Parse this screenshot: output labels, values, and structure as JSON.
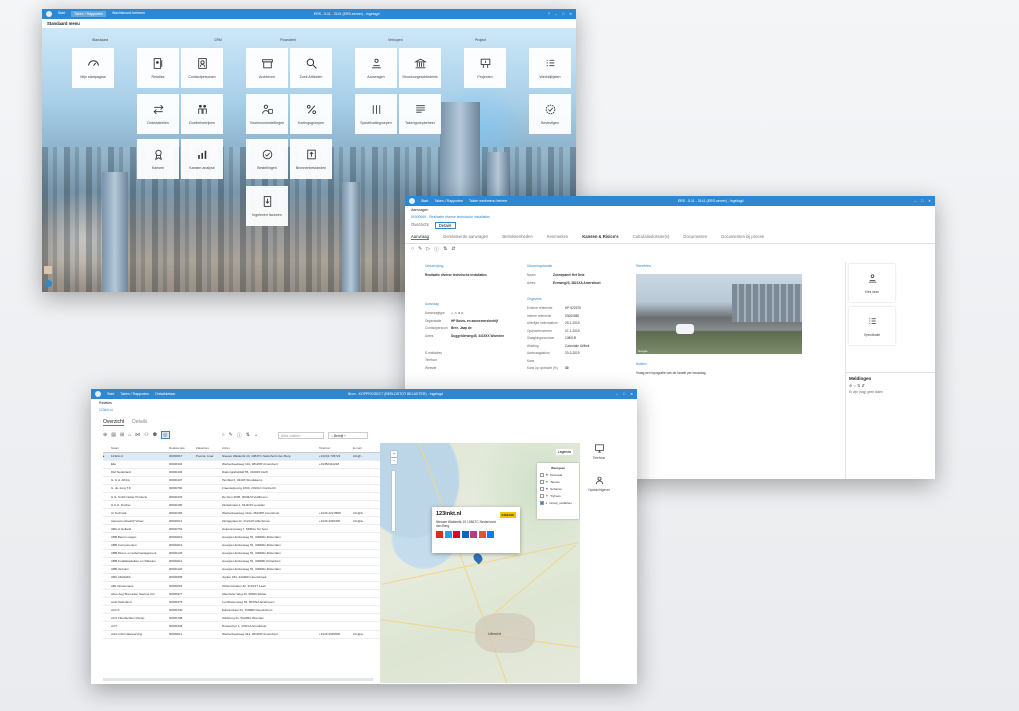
{
  "winA": {
    "title": "ERS - 5.11 - 3141 (ERS-server) - Ingelogd",
    "menu": [
      "Start",
      "Taken / Rapporten",
      "Wachtwoord beheren"
    ],
    "heading": "Standaard menu",
    "sections": [
      "Standaard",
      "CRM",
      "Financieel",
      "Verkopen",
      "Project"
    ],
    "tiles": [
      {
        "label": "Mijn startpagina",
        "icon": "dashboard-icon"
      },
      {
        "label": "Relaties",
        "icon": "contacts-icon"
      },
      {
        "label": "Contactpersonen",
        "icon": "person-card-icon"
      },
      {
        "label": "Archieven",
        "icon": "archive-icon"
      },
      {
        "label": "Zoek Artikelen",
        "icon": "search-icon"
      },
      {
        "label": "Aanvragen",
        "icon": "request-icon"
      },
      {
        "label": "Structuurgeschiedenis",
        "icon": "building-icon"
      },
      {
        "label": "Projecten",
        "icon": "projects-icon"
      },
      {
        "label": "Werkbijlijsten",
        "icon": "list-icon"
      },
      {
        "label": "Ordertabellen",
        "icon": "arrows-icon"
      },
      {
        "label": "Doelbeheerijsen",
        "icon": "people-icon"
      },
      {
        "label": "Voorkeursinstellingen",
        "icon": "user-settings-icon"
      },
      {
        "label": "Kortingsgroepen",
        "icon": "percent-icon"
      },
      {
        "label": "Specificatiegroepen",
        "icon": "lines-icon"
      },
      {
        "label": "Takengroepbeheer",
        "icon": "text-list-icon"
      },
      {
        "label": "Bevestigen",
        "icon": "badge-check-icon"
      },
      {
        "label": "Kansen",
        "icon": "award-icon"
      },
      {
        "label": "Kansen analyse",
        "icon": "bar-chart-icon"
      },
      {
        "label": "Bestellingen",
        "icon": "check-circle-icon"
      },
      {
        "label": "Bronnenbestanden",
        "icon": "export-icon"
      },
      {
        "label": "Ingelezen facturen",
        "icon": "invoice-import-icon"
      }
    ]
  },
  "winB": {
    "title": "ERS - 5.11 - 3141 (ERS-server) - Ingelogd",
    "menu": [
      "Start",
      "Taken / Rapporten",
      "Taken werkmenu beheer"
    ],
    "breadcrumb": "Aanvragen",
    "sub_breadcrumb": "00000669 - Realisatie diverse technische installaties",
    "view_tabs": [
      "Overzicht",
      "Details"
    ],
    "tabs": [
      "Aanvraag",
      "Gerelateerde aanvragen",
      "Betrokkenheden",
      "Kenmerken",
      "Kansen & Risico's",
      "Calculatiedossier(s)",
      "Documenten",
      "Documenten bij proces"
    ],
    "omschrijving": {
      "heading": "Omschrijving",
      "value": "Realisatie diverse technische installaties"
    },
    "aanvraag": {
      "heading": "Aanvraag",
      "rows": [
        {
          "k": "Aanvraagtype",
          "v": ""
        },
        {
          "k": "Organisatie",
          "v": "HP Bouw- en aannemersbedrijf"
        },
        {
          "k": "Contactpersoon",
          "v": "Bree, Jaap de"
        },
        {
          "k": "Adres",
          "v": "Duggelderweg45, 3415XX Woerden"
        },
        {
          "k": "",
          "v": ""
        },
        {
          "k": "E-mailadres",
          "v": ""
        },
        {
          "k": "Telefoon",
          "v": ""
        },
        {
          "k": "Website",
          "v": ""
        }
      ]
    },
    "uitvoering": {
      "heading": "Uitvoeringslocatie",
      "rows": [
        {
          "k": "Naam",
          "v": "Zonnepanel Het Dele"
        },
        {
          "k": "Adres",
          "v": "Eemweg23, 3821XA Amersfoort"
        }
      ]
    },
    "gegevens": {
      "heading": "Gegevens",
      "rows": [
        {
          "k": "Externe referentie",
          "v": "HP 522675"
        },
        {
          "k": "Interne referentie",
          "v": "00000580"
        },
        {
          "k": "Uiterlijke indiendatum",
          "v": "29-1-2019"
        },
        {
          "k": "Opdrachtnummer",
          "v": "07-1-2019"
        },
        {
          "k": "Slaagkingsnummer",
          "v": "1080LB"
        },
        {
          "k": "Afdeling",
          "v": "Calculatie Utiliteit"
        },
        {
          "k": "Aanvraagdatum",
          "v": "20-3-2019"
        },
        {
          "k": "Kans",
          "v": ""
        },
        {
          "k": "Kans op opdracht (%)",
          "v": "30"
        }
      ]
    },
    "streetview_label": "Streetview",
    "photo_caption": "Google",
    "notities": {
      "heading": "Notities",
      "value": "Vraag een topografie van de locatie per bouwdag"
    },
    "quick_actions": [
      {
        "label": "Kies deze",
        "icon": "user-hand-icon"
      },
      {
        "label": "Specificatie",
        "icon": "list-icon"
      }
    ],
    "meldingen": {
      "heading": "Meldingen",
      "empty": "Er zijn (nog) geen taken"
    }
  },
  "winC": {
    "title": "Bron - KOPPROGECT (BEELDSTOT BELASTER) - Ingelogd",
    "menu": [
      "Start",
      "Taken / Rapporten",
      "Ontwikkelaar"
    ],
    "breadcrumb": "Relaties",
    "sub_breadcrumb": "123ink.nl",
    "tabs": [
      "Overzicht",
      "Details"
    ],
    "search_placeholder": "Alles zoeken",
    "filter_label": "Bedrijf",
    "columns": [
      "",
      "Naam",
      "Relatiecode",
      "Zakacties",
      "Adres",
      "Telefoon",
      "E-mail"
    ],
    "rows": [
      [
        "▸",
        "123ink.nl",
        "00000617",
        "Poorsk, Lisar",
        "Nieuwe Walderitk 10, 1084TC Nederhorst den Berg",
        "+31(0)4 736723",
        "info@..."
      ],
      [
        "",
        "Elle",
        "00000434",
        "",
        "Werkenbeekweg 101, 3812RP Amersfoort",
        "+31352441218",
        ""
      ],
      [
        "",
        "DHI Nederland",
        "00000436",
        "",
        "Dieburgrahofdalf 55, 3100ZX Delft",
        "",
        ""
      ],
      [
        "",
        "G. & H. Alfrink",
        "00000437",
        "",
        "Tarnblat 6, 3340X Strookkamp",
        "",
        ""
      ],
      [
        "",
        "G. de Jong T.K",
        "00000790",
        "",
        "Fraenkelpoong 1000, 2010LC Dordrecht",
        "",
        ""
      ],
      [
        "",
        "H.G. Smith Nolter Products",
        "00000433",
        "",
        "De Kiun 3005, 3000LM Veldhoven",
        "",
        ""
      ],
      [
        "",
        "H.G.K. Fischer",
        "00000180",
        "",
        "Zinderlmaat 1, 6211NN Leusden",
        "",
        ""
      ],
      [
        "",
        "Ar Technisk",
        "00000184",
        "",
        "Werkenbeekweg 112a, 3812RP Amersfoort",
        "+3133-422 8800",
        "info@b..."
      ],
      [
        "",
        "Aannemersbedrijf Visser",
        "00000012",
        "",
        "Zindgeplaat 12, 2121AD Alfenhoven",
        "+3133-4092300",
        "info@a..."
      ],
      [
        "",
        "ABA of Holland",
        "00000764",
        "",
        "Hekonsmoweg 7, 5481bu Ter Apel",
        "",
        ""
      ],
      [
        "",
        "ABB Beurs Lasgen",
        "00000010",
        "",
        "Georgie Hintzenweg 81, 3008ZG Rotterdam",
        "",
        ""
      ],
      [
        "",
        "ABB Componenten",
        "00000013",
        "",
        "Georgie Hintzenweg 81, 3008ZG Rotterdam",
        "",
        ""
      ],
      [
        "",
        "ABB Direct- en kabelmanagement",
        "00000126",
        "",
        "Georgie Hintzenweg 81, 3008ZG Rotterdam",
        "",
        ""
      ],
      [
        "",
        "ABB Installatieduiken en Sikkelen",
        "00000011",
        "",
        "Georgie Hintzenweg 81, 3008ZK Rotterdam",
        "",
        ""
      ],
      [
        "",
        "ABB Vertulen",
        "00000120",
        "",
        "Georgie Hintzenweg 81, 3008ZG Rotterdam",
        "",
        ""
      ],
      [
        "",
        "ABC ADAMAS",
        "00000605",
        "",
        "Jupiter 184, 3444DD Hoensbroek",
        "",
        ""
      ],
      [
        "",
        "ABL Driesemans",
        "00000015",
        "",
        "Obbensstraten 22, 3161ST Laad",
        "",
        ""
      ],
      [
        "",
        "Abus Aug Bremicker Soehne KG",
        "00000977",
        "",
        "Altenhofer Weg 25, 58300 Wetter",
        "",
        ""
      ],
      [
        "",
        "Acal Nederland",
        "00000075",
        "",
        "Luchthavenweg 53, 5657EA Eindhoven",
        "",
        ""
      ],
      [
        "",
        "ACCS",
        "00000440",
        "",
        "Edisonstraat 34, 7009RD Doetinchem",
        "",
        ""
      ],
      [
        "",
        "ACS Fiberfachten (illyria)",
        "00000798",
        "",
        "Stinkburg 61, 5022BA Woerden",
        "",
        ""
      ],
      [
        "",
        "ACT",
        "00000438",
        "",
        "Dinwetcher 1, 4702LA Stroobhuiz",
        "",
        ""
      ],
      [
        "",
        "Actiz Informatiewerving",
        "00000011",
        "",
        "Werkenbeekweg 31a, 3812RP Amersfoort",
        "+3133-4629600",
        "info@a..."
      ]
    ],
    "map": {
      "card_title": "123inkt.nl",
      "card_address": "Nieuwe Walderitk 10 1084TC Nederhorst den Berg",
      "card_badge": "KINESIO",
      "legend_label": "Legenda",
      "layers_title": "Weergave",
      "layers": [
        "Dorsvaal",
        "Tanium",
        "Scharrar",
        "Tryhacs",
        "Groep_ewilarties"
      ],
      "place_label": "Utrecht"
    },
    "side_buttons": [
      {
        "label": "Telefoon",
        "icon": "monitor-icon"
      },
      {
        "label": "Opdrachtgever",
        "icon": "person-icon"
      }
    ]
  }
}
